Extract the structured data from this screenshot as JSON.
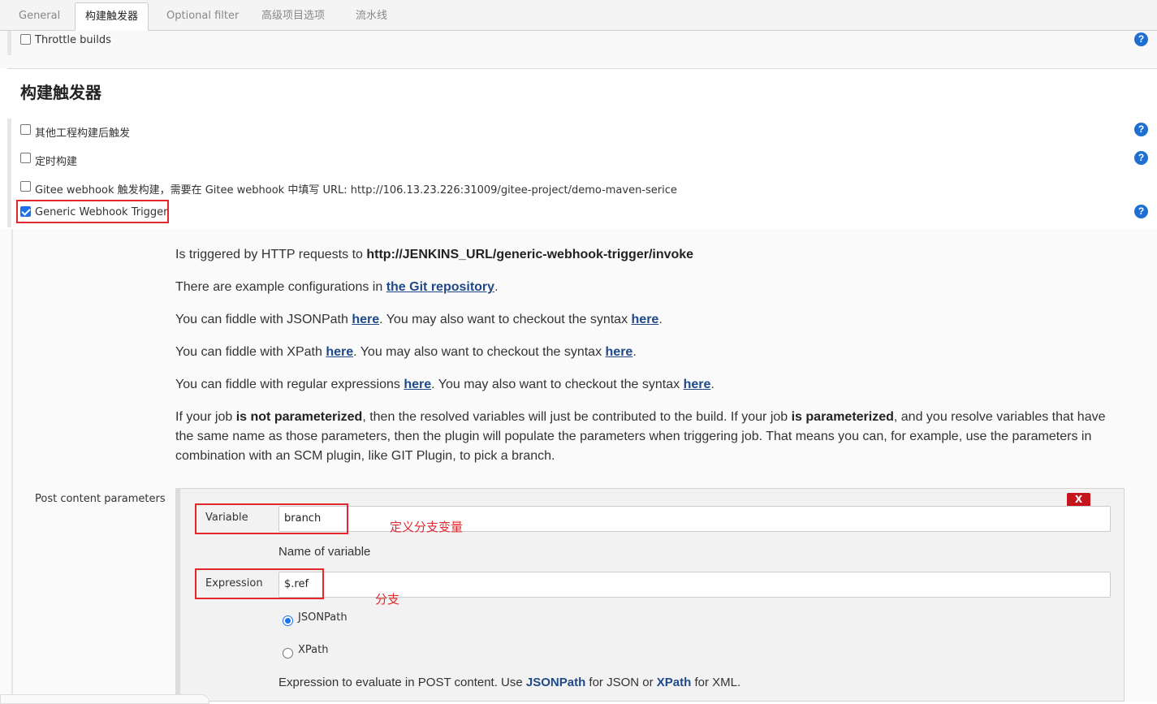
{
  "tabs": [
    "General",
    "构建触发器",
    "Optional filter",
    "高级项目选项",
    "流水线"
  ],
  "throttle_builds": "Throttle builds",
  "section_title": "构建触发器",
  "triggers": [
    "其他工程构建后触发",
    "定时构建",
    "Gitee webhook 触发构建，需要在 Gitee webhook 中填写 URL: http://106.13.23.226:31009/gitee-project/demo-maven-serice",
    "Generic Webhook Trigger"
  ],
  "trigger_checked": [
    false,
    false,
    false,
    true
  ],
  "help_glyph": "?",
  "desc": {
    "l1_a": "Is triggered by HTTP requests to ",
    "l1_b": "http://JENKINS_URL/generic-webhook-trigger/invoke",
    "l2_a": "There are example configurations in ",
    "l2_link": "the Git repository",
    "l2_b": ".",
    "l3_a": "You can fiddle with JSONPath ",
    "l3_link1": "here",
    "l3_b": ". You may also want to checkout the syntax ",
    "l3_link2": "here",
    "l3_c": ".",
    "l4_a": "You can fiddle with XPath ",
    "l4_link1": "here",
    "l4_b": ". You may also want to checkout the syntax ",
    "l4_link2": "here",
    "l4_c": ".",
    "l5_a": "You can fiddle with regular expressions ",
    "l5_link1": "here",
    "l5_b": ". You may also want to checkout the syntax ",
    "l5_link2": "here",
    "l5_c": ".",
    "l6_a": "If your job ",
    "l6_b1": "is not parameterized",
    "l6_c": ", then the resolved variables will just be contributed to the build. If your job ",
    "l6_b2": "is parameterized",
    "l6_d": ", and you resolve variables that have the same name as those parameters, then the plugin will populate the parameters when triggering job. That means you can, for example, use the parameters in combination with an SCM plugin, like GIT Plugin, to pick a branch."
  },
  "post_params": {
    "label": "Post content parameters",
    "delete_btn": "X",
    "variable_label": "Variable",
    "variable_value": "branch",
    "variable_hint": "Name of variable",
    "expression_label": "Expression",
    "expression_value": "$.ref",
    "radio_jsonpath": "JSONPath",
    "radio_xpath": "XPath",
    "radio_selected": "JSONPath",
    "expr_hint_a": "Expression to evaluate in POST content. Use ",
    "expr_hint_link1": "JSONPath",
    "expr_hint_b": " for JSON or ",
    "expr_hint_link2": "XPath",
    "expr_hint_c": " for XML."
  },
  "annotations": {
    "variable_note": "定义分支变量",
    "expression_note": "分支"
  },
  "colors": {
    "annotation_red": "#e0282e",
    "link": "#204a87",
    "help_blue": "#1e6fd2"
  }
}
